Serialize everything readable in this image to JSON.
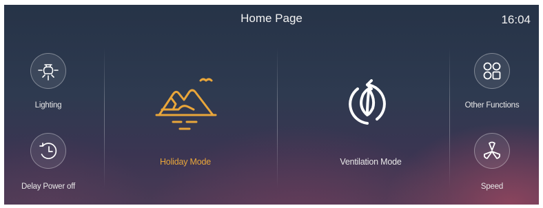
{
  "header": {
    "title": "Home Page",
    "time": "16:04"
  },
  "tiles": {
    "lighting": {
      "label": "Lighting",
      "icon": "bulb-icon"
    },
    "delay_power_off": {
      "label": "Delay Power off",
      "icon": "timer-icon"
    },
    "holiday_mode": {
      "label": "Holiday Mode",
      "icon": "mountain-landscape-icon"
    },
    "ventilation_mode": {
      "label": "Ventilation Mode",
      "icon": "leaf-cycle-icon"
    },
    "other_functions": {
      "label": "Other Functions",
      "icon": "grid-icon"
    },
    "speed": {
      "label": "Speed",
      "icon": "fan-icon"
    }
  },
  "colors": {
    "accent": "#e9a63a",
    "text": "#e8e8e8"
  }
}
